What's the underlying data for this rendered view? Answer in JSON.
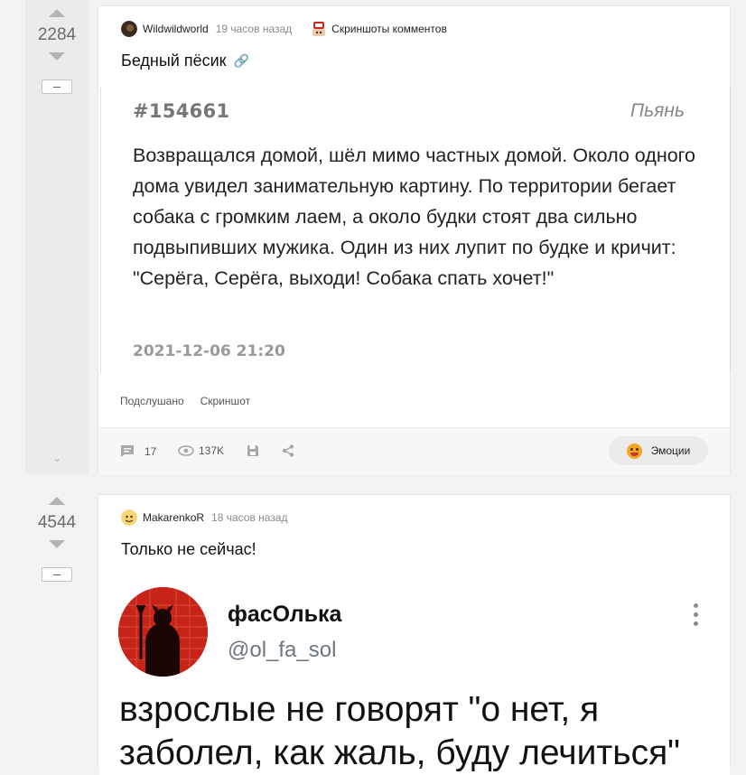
{
  "post1": {
    "rating": "2284",
    "author": "Wildwildworld",
    "time": "19 часов назад",
    "community": "Скриншоты комментов",
    "title": "Бедный пёсик",
    "quote": {
      "id": "#154661",
      "tag": "Пьянь",
      "text": "Возвращался домой, шёл мимо частных домой. Около одного дома увидел занимательную картину. По территории бегает собака с громким лаем, а около будки стоят два сильно подвыпивших мужика. Один из них лупит по будке и кричит: \"Серёга, Серёга, выходи! Собака спать хочет!\"",
      "date": "2021-12-06 21:20"
    },
    "tags": [
      "Подслушано",
      "Скриншот"
    ],
    "comments": "17",
    "views": "137K",
    "emotions_label": "Эмоции"
  },
  "post2": {
    "rating": "4544",
    "author": "MakarenkoR",
    "time": "18 часов назад",
    "title": "Только не сейчас!",
    "tweet": {
      "name": "фасОлька",
      "handle": "@ol_fa_sol",
      "text_line1": "взрослые не говорят \"о нет, я",
      "text_line2": "заболел, как жаль, буду лечиться\""
    }
  },
  "colors": {
    "background": "#f2f2f2",
    "card": "#ffffff",
    "muted": "#8a8a8a",
    "tweet_avatar": "#c62418"
  }
}
